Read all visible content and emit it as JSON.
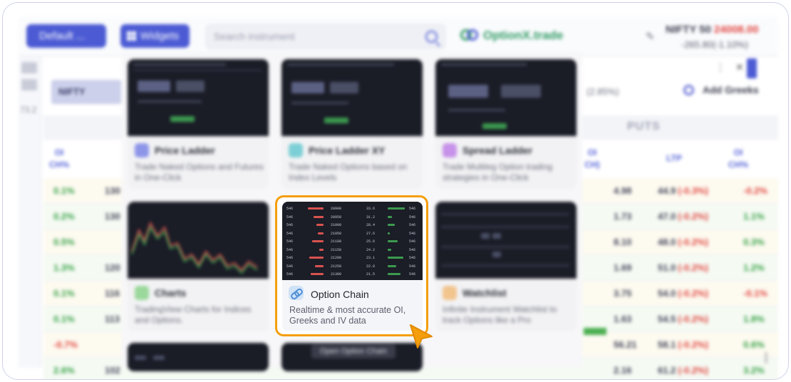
{
  "topbar": {
    "default_label": "Default ...",
    "widgets_label": "Widgets",
    "search_placeholder": "Search instrument",
    "brand": "OptionX.trade",
    "index_name": "NIFTY 50",
    "index_price": "24008.00",
    "index_change": "-265.80(-1.10%)"
  },
  "left_panel": {
    "side_number": "73.2"
  },
  "chain": {
    "instrument": "NIFTY",
    "pct": "(2.85%)",
    "add_greeks": "Add Greeks",
    "puts_label": "PUTS",
    "left_headers": {
      "oi": "OI",
      "oi_chg": "CH%"
    },
    "right_headers": {
      "oi_chg_col": "OI CH)",
      "ltp": "LTP",
      "oi": "OI",
      "oi_chg": "CH%"
    },
    "left_rows": [
      {
        "pct": "0.1%",
        "oi": "130"
      },
      {
        "pct": "0.2%",
        "oi": "130"
      },
      {
        "pct": "0.5%",
        "oi": ""
      },
      {
        "pct": "1.3%",
        "oi": "120"
      },
      {
        "pct": "0.1%",
        "oi": "116"
      },
      {
        "pct": "0.1%",
        "oi": "113"
      },
      {
        "pct": "-0.7%",
        "oi": ""
      },
      {
        "pct": "2.6%",
        "oi": "102"
      }
    ],
    "right_rows": [
      {
        "v1": "4.98",
        "ltp": "44.9",
        "ltp_chg": "(-0.3%)",
        "oi_chg": "-0.2%"
      },
      {
        "v1": "1.73",
        "ltp": "47.0",
        "ltp_chg": "(-0.2%)",
        "oi_chg": "1.1%"
      },
      {
        "v1": "8.10",
        "ltp": "48.0",
        "ltp_chg": "(-0.2%)",
        "oi_chg": "0.3%"
      },
      {
        "v1": "1.69",
        "ltp": "51.0",
        "ltp_chg": "(-0.2%)",
        "oi_chg": "1.2%"
      },
      {
        "v1": "3.75",
        "ltp": "54.0",
        "ltp_chg": "(-0.2%)",
        "oi_chg": "-0.1%"
      },
      {
        "v1": "1.63",
        "ltp": "54.5",
        "ltp_chg": "(-0.2%)",
        "oi_chg": "1.8%"
      },
      {
        "v1": "56.21",
        "ltp": "58.1",
        "ltp_chg": "(-0.2%)",
        "oi_chg": "0.6%"
      },
      {
        "v1": "2.16",
        "ltp": "61.2",
        "ltp_chg": "(-0.2%)",
        "oi_chg": "3.2%"
      }
    ]
  },
  "widgets": [
    {
      "title": "Price Ladder",
      "desc": "Trade Naked Options and Futures in One-Click",
      "icon": "ladder-icon",
      "icon_color": "#8d95e8"
    },
    {
      "title": "Price Ladder XY",
      "desc": "Trade Naked Options based on Index Levels",
      "icon": "ladder-xy-icon",
      "icon_color": "#7ccfd6"
    },
    {
      "title": "Spread Ladder",
      "desc": "Trade Multileg Option trading strategies in One-Click",
      "icon": "spread-icon",
      "icon_color": "#c792e9"
    },
    {
      "title": "Charts",
      "desc": "TradingView Charts for Indices and Options.",
      "icon": "chart-icon",
      "icon_color": "#9bd89b"
    },
    {
      "title": "Option Chain",
      "desc": "Realtime & most accurate OI, Greeks and IV data",
      "icon": "link-icon",
      "icon_color": "#cfe3f7"
    },
    {
      "title": "Watchlist",
      "desc": "Infinite Instrument Watchlist to track Options like a Pro",
      "icon": "watchlist-icon",
      "icon_color": "#f2c48e"
    }
  ],
  "thumb_buttons": {
    "left": "MKBC",
    "right": "Lmt"
  },
  "option_chain_thumb": {
    "strikes": [
      "20900",
      "20950",
      "21000",
      "21050",
      "21100",
      "21150",
      "21200",
      "21250",
      "21300"
    ],
    "ltps": [
      "33.6",
      "31.2",
      "28.4",
      "27.6",
      "25.6",
      "24.2",
      "23.1",
      "22.0",
      "21.5"
    ],
    "side": "546"
  },
  "tooltip": "Open Option Chain",
  "colors": {
    "accent": "#4c5bd4",
    "highlight": "#f59e0b",
    "positive": "#35a145",
    "negative": "#e0443e"
  }
}
